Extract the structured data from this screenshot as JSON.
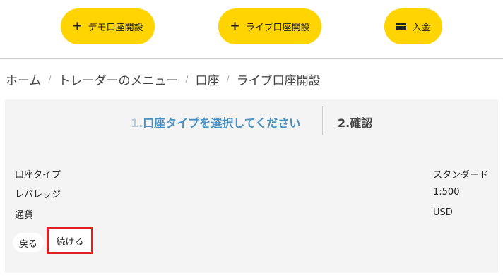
{
  "header": {
    "buttons": [
      {
        "label": "デモ口座開設",
        "icon": "plus-icon"
      },
      {
        "label": "ライブ口座開設",
        "icon": "plus-icon"
      },
      {
        "label": "入金",
        "icon": "card-icon"
      }
    ],
    "accent_color": "#ffd400"
  },
  "breadcrumb": {
    "items": [
      "ホーム",
      "トレーダーのメニュー",
      "口座",
      "ライブ口座開設"
    ],
    "separator": "/"
  },
  "steps": {
    "step1": {
      "number": "1.",
      "label": "口座タイプを選択してください"
    },
    "step2": {
      "label": "2.確認"
    }
  },
  "details": {
    "rows": [
      {
        "label": "口座タイプ",
        "value": "スタンダード"
      },
      {
        "label": "レバレッジ",
        "value": "1:500"
      },
      {
        "label": "通貨",
        "value": "USD"
      }
    ]
  },
  "actions": {
    "back_label": "戻る",
    "continue_label": "続ける",
    "highlight_color": "#e0201f"
  }
}
